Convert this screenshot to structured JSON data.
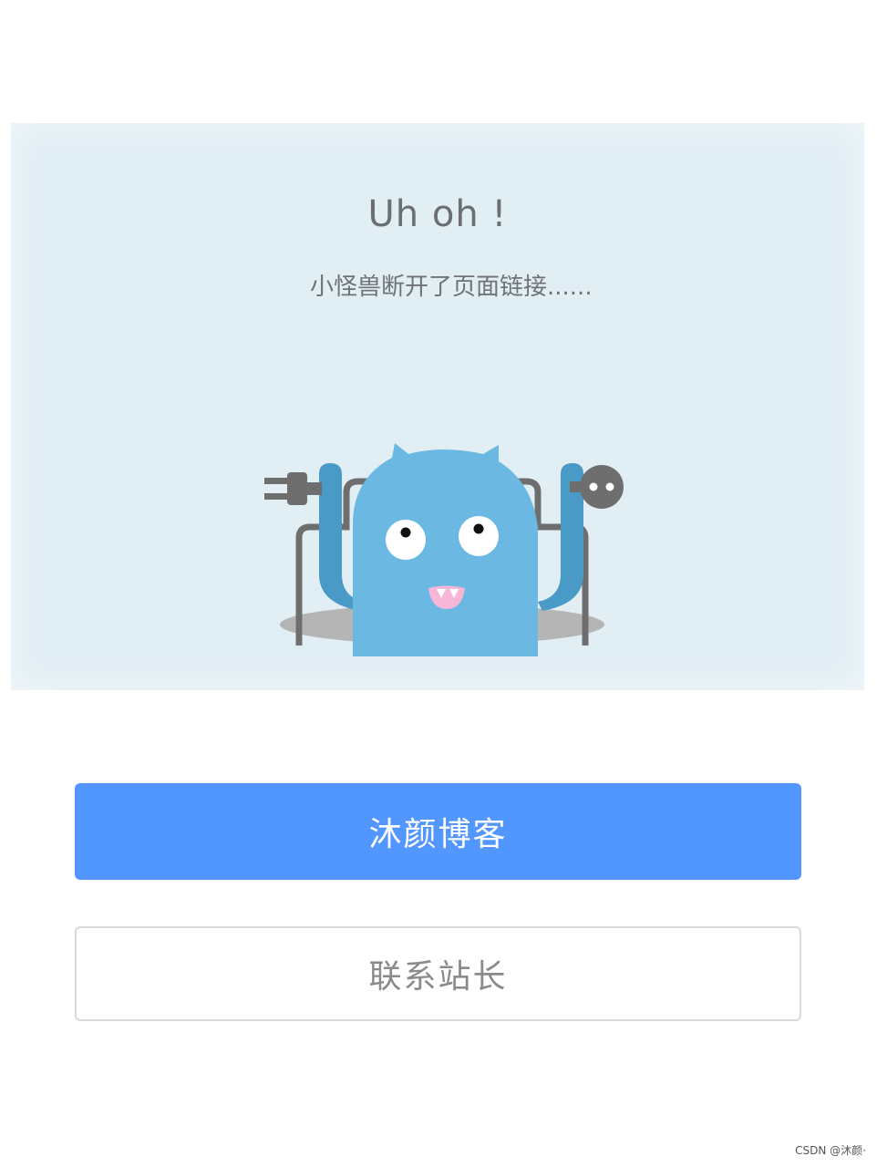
{
  "hero": {
    "title": "Uh oh !",
    "subtitle": "小怪兽断开了页面链接......"
  },
  "buttons": {
    "primary_label": "沐颜博客",
    "secondary_label": "联系站长"
  },
  "watermark": "CSDN @沐颜·",
  "colors": {
    "hero_background": "#e1eef4",
    "primary_button": "#5297ff",
    "monster_body": "#6bb8e3"
  },
  "illustration": {
    "name": "disconnected-monster-illustration"
  }
}
